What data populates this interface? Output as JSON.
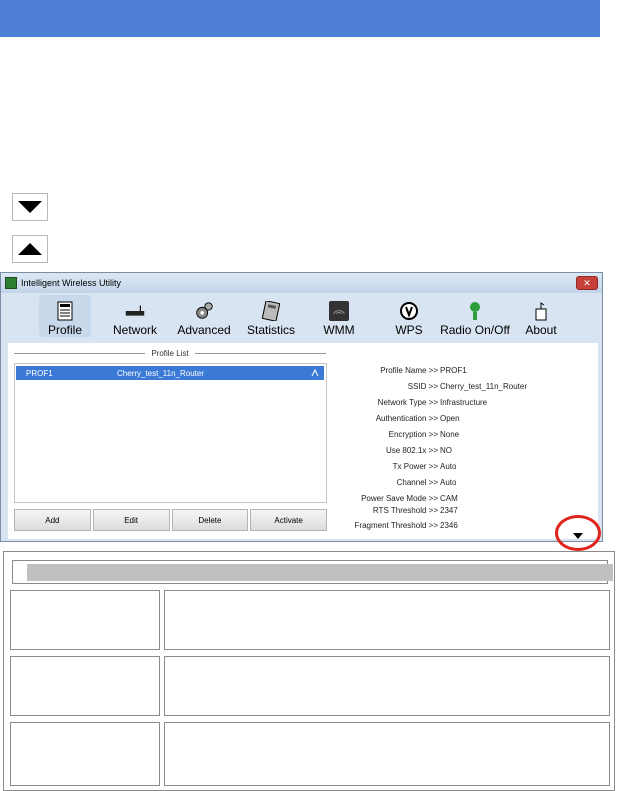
{
  "window": {
    "title": "Intelligent Wireless Utility",
    "close_label": "✕"
  },
  "toolbar": [
    {
      "label": "Profile",
      "icon": "profile-icon"
    },
    {
      "label": "Network",
      "icon": "network-icon"
    },
    {
      "label": "Advanced",
      "icon": "advanced-icon"
    },
    {
      "label": "Statistics",
      "icon": "statistics-icon"
    },
    {
      "label": "WMM",
      "icon": "wmm-icon"
    },
    {
      "label": "WPS",
      "icon": "wps-icon"
    },
    {
      "label": "Radio On/Off",
      "icon": "radio-icon"
    },
    {
      "label": "About",
      "icon": "about-icon"
    }
  ],
  "profile_list": {
    "title": "Profile List",
    "rows": [
      {
        "name": "PROF1",
        "ssid": "Cherry_test_11n_Router"
      }
    ]
  },
  "buttons": {
    "add": "Add",
    "edit": "Edit",
    "delete": "Delete",
    "activate": "Activate"
  },
  "details": [
    {
      "label": "Profile Name >>",
      "value": "PROF1"
    },
    {
      "label": "SSID >>",
      "value": "Cherry_test_11n_Router"
    },
    {
      "label": "Network Type >>",
      "value": "Infrastructure"
    },
    {
      "label": "Authentication >>",
      "value": "Open"
    },
    {
      "label": "Encryption >>",
      "value": "None"
    },
    {
      "label": "Use 802.1x >>",
      "value": "NO"
    },
    {
      "label": "Tx Power >>",
      "value": "Auto"
    },
    {
      "label": "Channel >>",
      "value": "Auto"
    },
    {
      "label": "Power Save Mode >>",
      "value": "CAM"
    },
    {
      "label": "RTS Threshold >>",
      "value": "2347"
    },
    {
      "label": "Fragment Threshold >>",
      "value": "2346"
    }
  ],
  "colors": {
    "banner": "#4d7fd6",
    "selected_row": "#3b79d6",
    "highlight_circle": "#e0241b"
  }
}
